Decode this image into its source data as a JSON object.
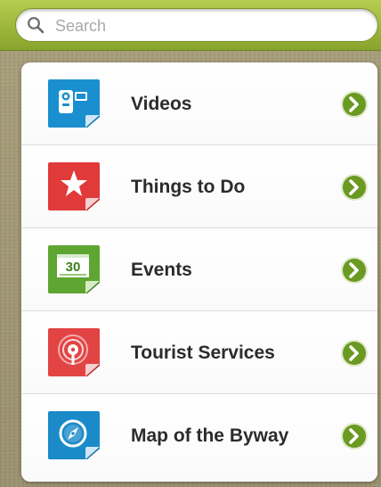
{
  "search": {
    "placeholder": "Search",
    "value": ""
  },
  "menu": {
    "items": [
      {
        "label": "Videos",
        "icon": "video-camera-icon",
        "color": "#1a8fcf"
      },
      {
        "label": "Things to Do",
        "icon": "star-icon",
        "color": "#e03a3a"
      },
      {
        "label": "Events",
        "icon": "calendar-icon",
        "day": "30",
        "color": "#5fa532"
      },
      {
        "label": "Tourist Services",
        "icon": "info-broadcast-icon",
        "color": "#e24444"
      },
      {
        "label": "Map of the Byway",
        "icon": "compass-icon",
        "color": "#1b8ac8"
      }
    ]
  },
  "colors": {
    "search_bar_green": "#9cb63a",
    "chevron_green": "#6a9a22",
    "background_texture": "#a59c78"
  }
}
